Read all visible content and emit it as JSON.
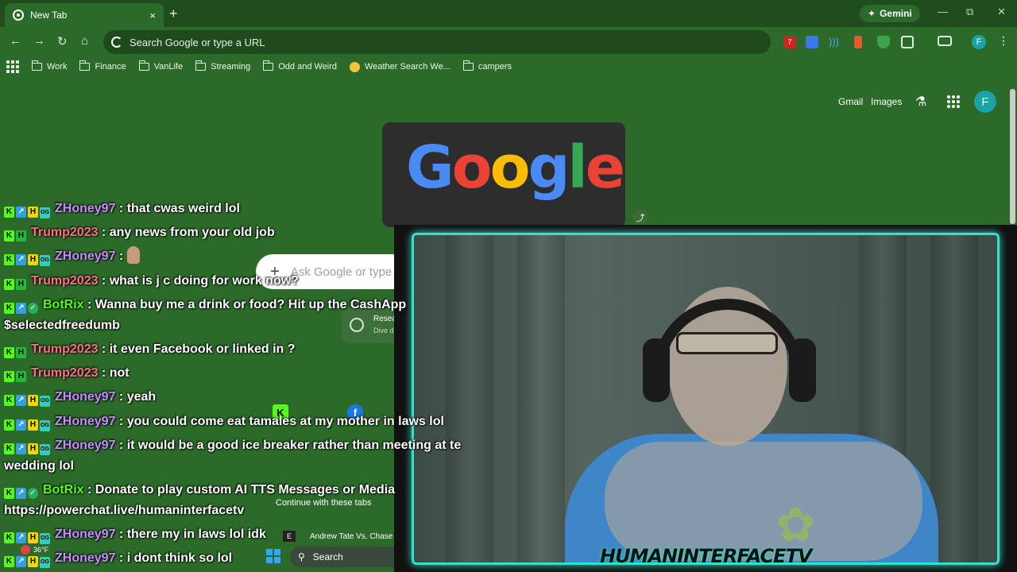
{
  "browser": {
    "tab_title": "New Tab",
    "tab_close": "×",
    "new_tab": "+",
    "gemini_label": "Gemini",
    "omnibox_placeholder": "Search Google or type a URL",
    "profile_initial": "F",
    "extension_badge": "7",
    "win_minimize": "—",
    "win_maximize": "⧉",
    "win_close": "✕"
  },
  "bookmarks": [
    {
      "label": "Work",
      "icon": "folder-icon"
    },
    {
      "label": "Finance",
      "icon": "folder-icon"
    },
    {
      "label": "VanLife",
      "icon": "folder-icon"
    },
    {
      "label": "Streaming",
      "icon": "folder-icon"
    },
    {
      "label": "Odd and Weird",
      "icon": "folder-icon"
    },
    {
      "label": "Weather Search We...",
      "icon": "weather-icon"
    },
    {
      "label": "campers",
      "icon": "folder-icon"
    }
  ],
  "ntp": {
    "gmail": "Gmail",
    "images": "Images",
    "doodle_text": "Google",
    "ask_placeholder": "Ask Google or type",
    "research_title": "Resea",
    "research_sub": "Dive d",
    "continue_label": "Continue with these tabs",
    "recent_tab": "Andrew Tate Vs. Chase",
    "recent_tab_icon": "E"
  },
  "chat": [
    {
      "badges": [
        "k",
        "sub",
        "h",
        "og"
      ],
      "user": "ZHoney97",
      "color": "zh",
      "text": "that cwas weird lol"
    },
    {
      "badges": [
        "k",
        "hh"
      ],
      "user": "Trump2023",
      "color": "tr",
      "text": "any news from your old job"
    },
    {
      "badges": [
        "k",
        "sub",
        "h",
        "og"
      ],
      "user": "ZHoney97",
      "color": "zh",
      "text": "",
      "emote": true
    },
    {
      "badges": [
        "k",
        "hh"
      ],
      "user": "Trump2023",
      "color": "tr",
      "text": "what is j c doing for work now?"
    },
    {
      "badges": [
        "k",
        "sub",
        "check"
      ],
      "user": "BotRix",
      "color": "bot",
      "text": "Wanna buy me a drink or food? Hit up the CashApp $selectedfreedumb"
    },
    {
      "badges": [
        "k",
        "hh"
      ],
      "user": "Trump2023",
      "color": "tr",
      "text": "it even Facebook or linked in ?"
    },
    {
      "badges": [
        "k",
        "hh"
      ],
      "user": "Trump2023",
      "color": "tr",
      "text": "not"
    },
    {
      "badges": [
        "k",
        "sub",
        "h",
        "og"
      ],
      "user": "ZHoney97",
      "color": "zh",
      "text": "yeah"
    },
    {
      "badges": [
        "k",
        "sub",
        "h",
        "og"
      ],
      "user": "ZHoney97",
      "color": "zh",
      "text": "you could come eat tamales at my mother in laws lol"
    },
    {
      "badges": [
        "k",
        "sub",
        "h",
        "og"
      ],
      "user": "ZHoney97",
      "color": "zh",
      "text": "it would be a good ice breaker rather than meeting at te wedding lol"
    },
    {
      "badges": [
        "k",
        "sub",
        "check"
      ],
      "user": "BotRix",
      "color": "bot",
      "text": "Donate to play custom AI TTS Messages or Media https://powerchat.live/humaninterfacetv"
    },
    {
      "badges": [
        "k",
        "sub",
        "h",
        "og"
      ],
      "user": "ZHoney97",
      "color": "zh",
      "text": "there my in laws lol idk"
    },
    {
      "badges": [
        "k",
        "sub",
        "h",
        "og"
      ],
      "user": "ZHoney97",
      "color": "zh",
      "text": "i dont think so lol"
    }
  ],
  "webcam": {
    "brand": "HUMANINTERFACETV",
    "frame_color": "#34e0c8"
  },
  "taskbar": {
    "temperature": "36°F",
    "search_label": "Search"
  },
  "colors": {
    "theme_bg": "#2c6a2a",
    "titlebar_bg": "#1f4d1d",
    "user_zhoney": "#c68bff",
    "user_trump": "#ff6e86",
    "user_botrix": "#53fc18"
  }
}
